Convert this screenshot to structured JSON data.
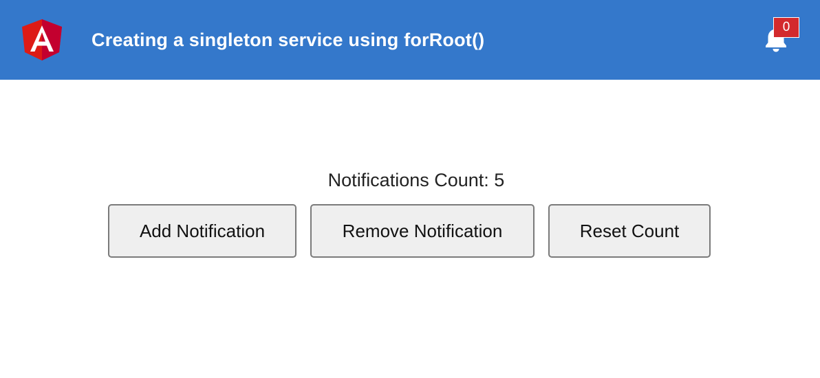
{
  "header": {
    "title": "Creating a singleton service using forRoot()",
    "logo_icon": "angular-logo-icon",
    "logo_letter": "A",
    "background_color": "#3478cb",
    "notifications": {
      "icon": "bell-icon",
      "badge_count": "0",
      "badge_color": "#d32a2d"
    }
  },
  "main": {
    "count_text": "Notifications Count: 5",
    "buttons": {
      "add_label": "Add Notification",
      "remove_label": "Remove Notification",
      "reset_label": "Reset Count"
    }
  }
}
